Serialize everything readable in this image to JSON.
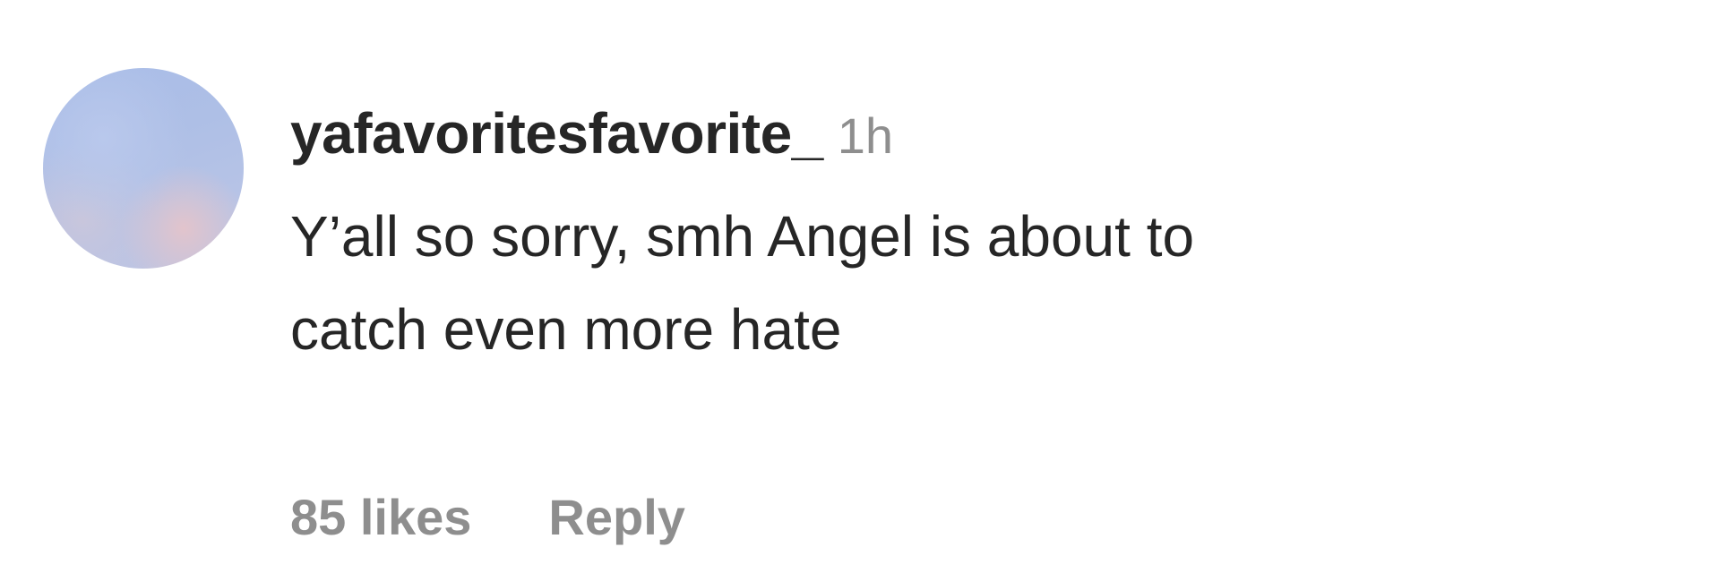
{
  "comment": {
    "username": "yafavoritesfavorite_",
    "time": "1h",
    "text_line1": "Y’all so sorry, smh Angel is about to",
    "text_line2": "catch even more hate",
    "likes": "85 likes",
    "reply_label": "Reply"
  }
}
